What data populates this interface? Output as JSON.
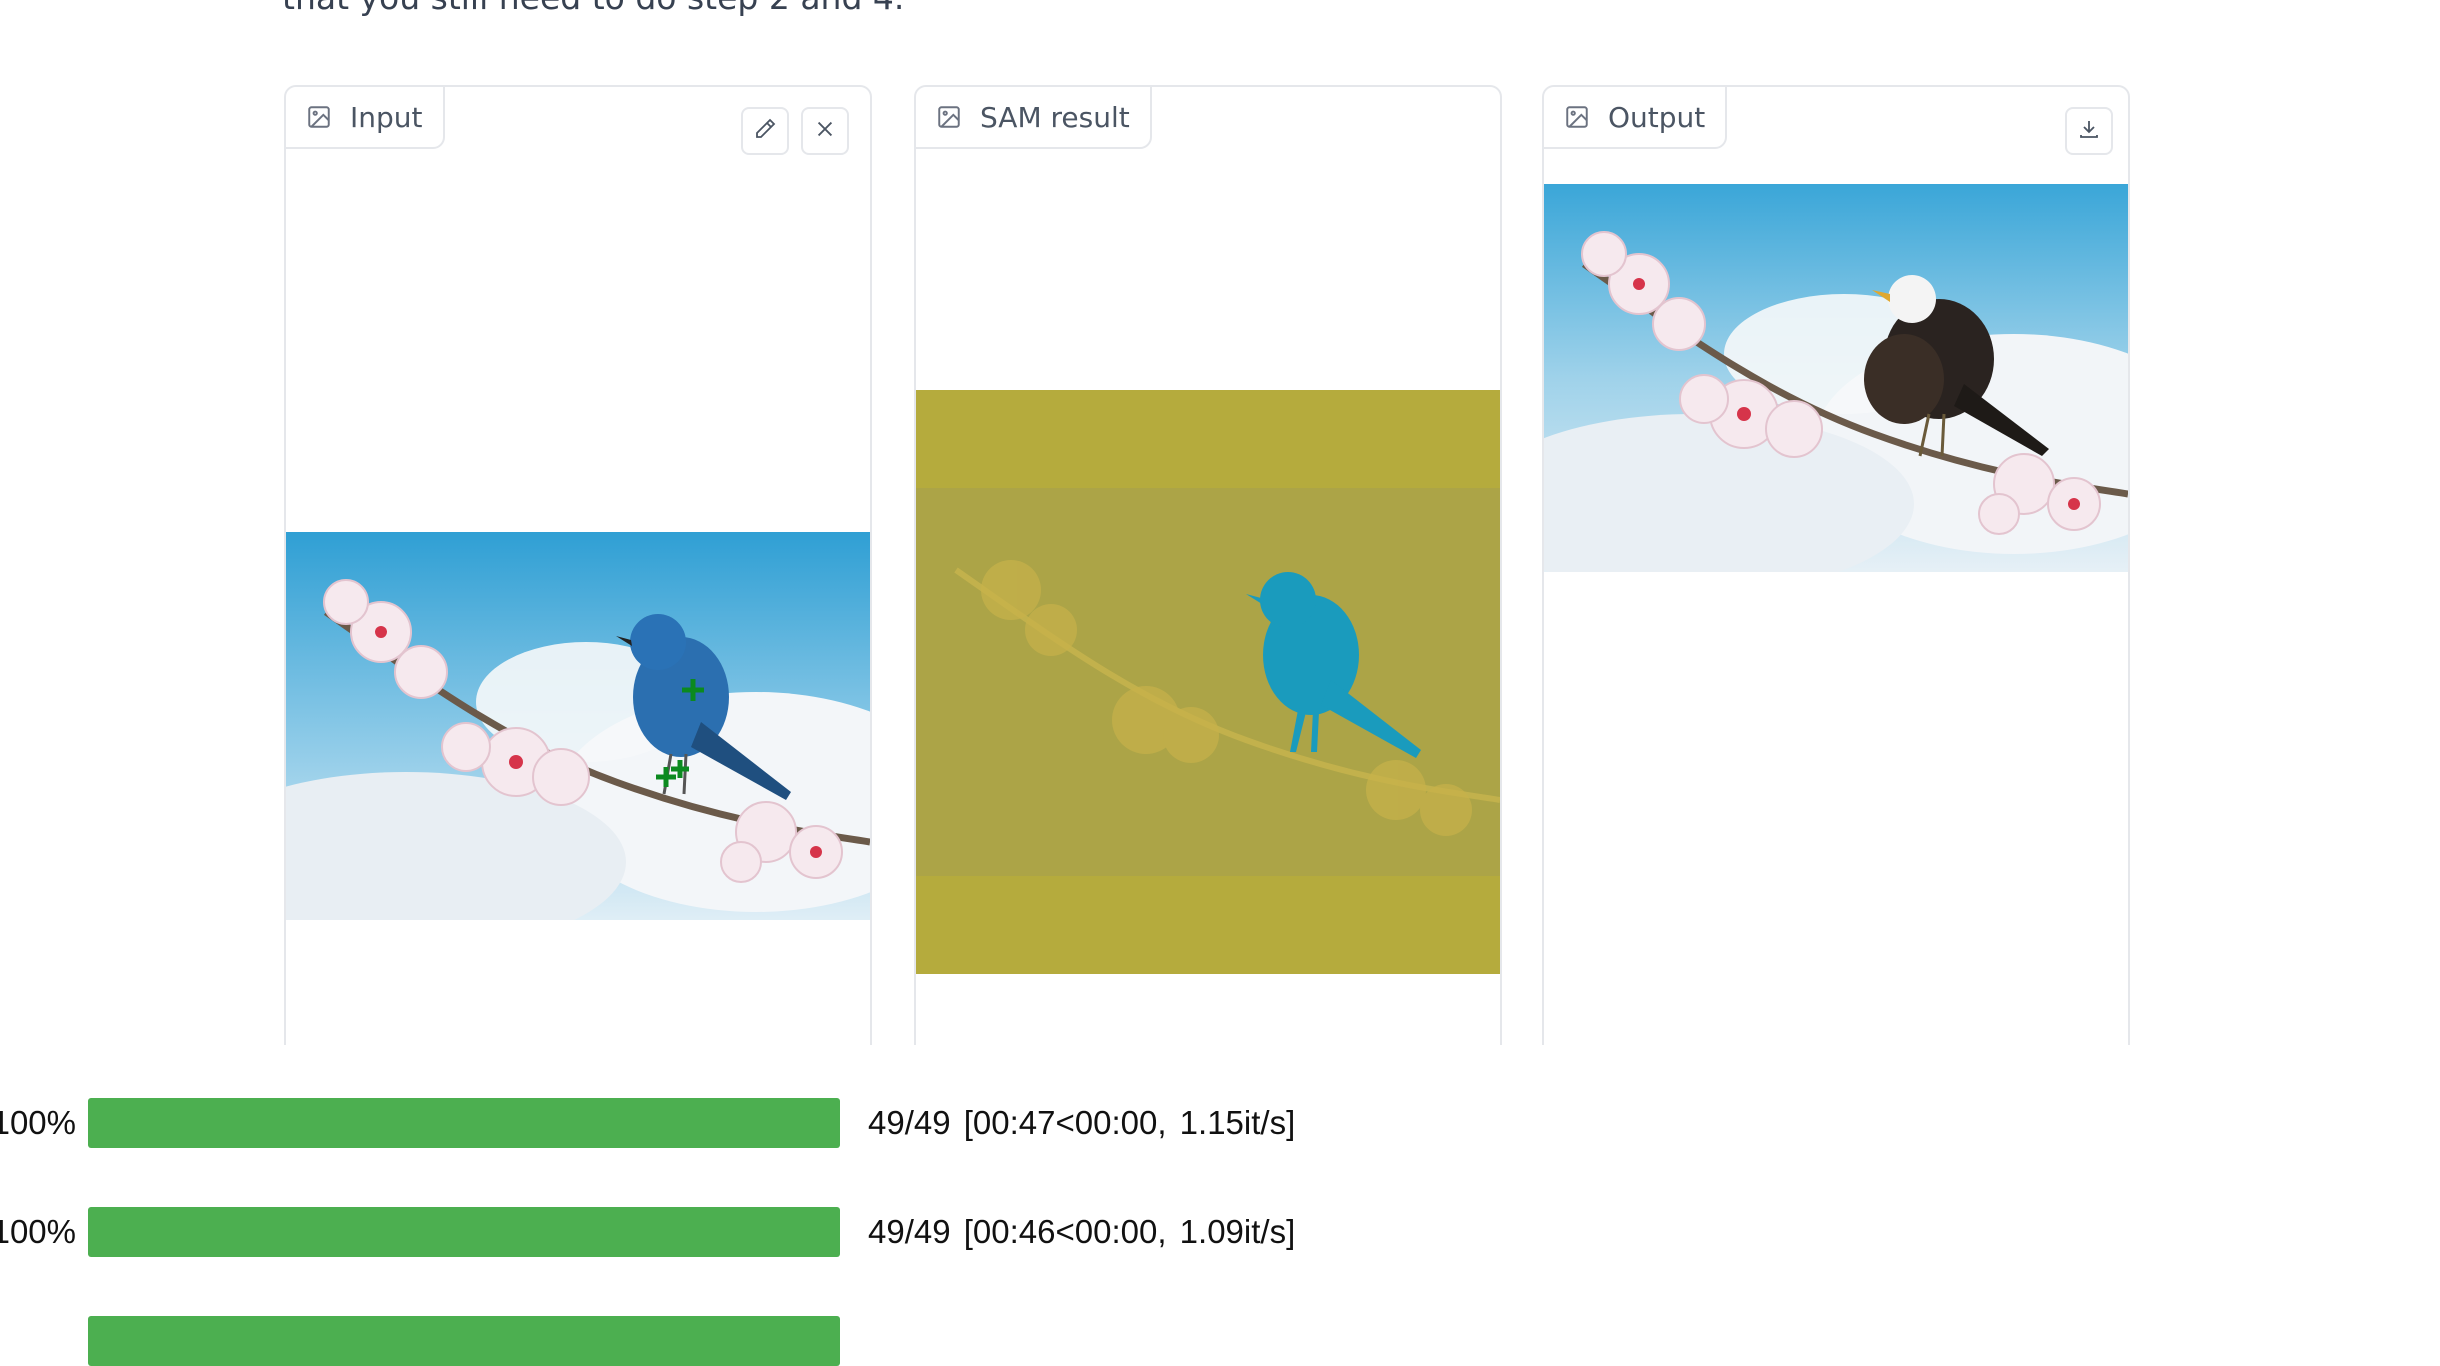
{
  "intro_text": "that you still need to do step 2 and 4.",
  "panels": {
    "input": {
      "label": "Input",
      "label_icon": "image-icon",
      "actions": [
        "pencil-icon",
        "close-icon"
      ]
    },
    "sam": {
      "label": "SAM result",
      "label_icon": "image-icon"
    },
    "output": {
      "label": "Output",
      "label_icon": "image-icon",
      "actions": [
        "download-icon"
      ]
    }
  },
  "colors": {
    "progress_fill": "#4caf50",
    "sam_mask": "#b5ab3d",
    "sam_bird": "#1a9bbd",
    "sky": "#4fb3dd"
  },
  "progress": [
    {
      "percent_label": "100%",
      "fraction": 1.0,
      "stats": "49/49 [00:47<00:00,    1.15it/s]"
    },
    {
      "percent_label": "100%",
      "fraction": 1.0,
      "stats": "49/49 [00:46<00:00,    1.09it/s]"
    },
    {
      "percent_label": "",
      "fraction": 1.0,
      "stats": ""
    }
  ]
}
